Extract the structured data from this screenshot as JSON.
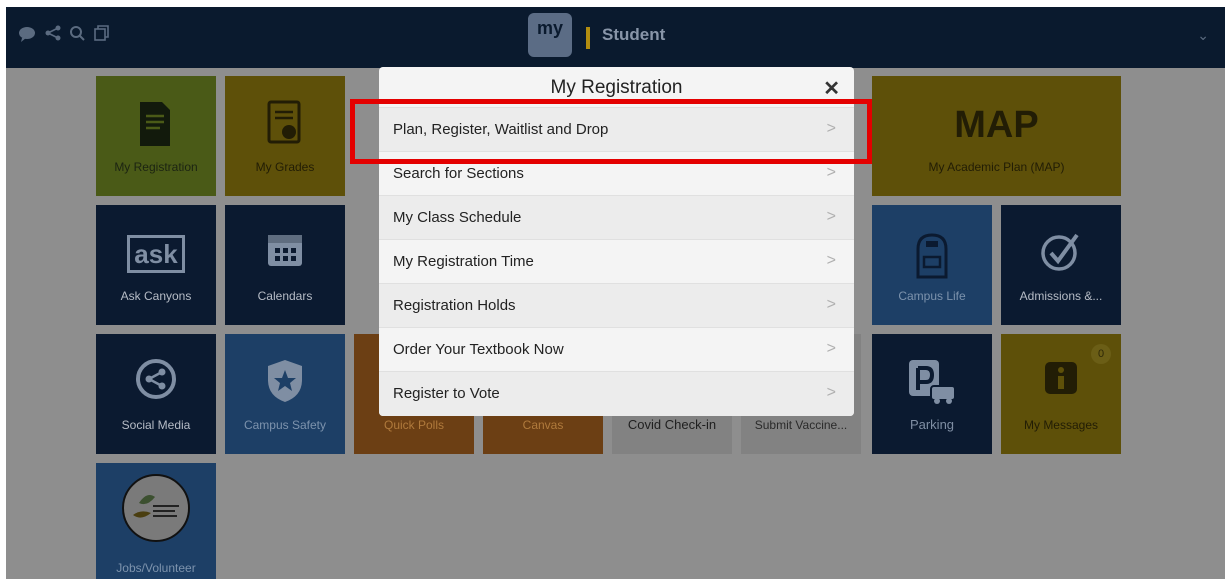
{
  "topbar": {
    "title": "Student",
    "logo_text": "my",
    "icons": [
      "chat-icon",
      "share-icon",
      "search-icon",
      "copy-icon"
    ],
    "chevron": "⌄"
  },
  "tiles": [
    {
      "label": "My Registration",
      "icon": "document-edit-icon"
    },
    {
      "label": "My Grades",
      "icon": "certificate-icon"
    },
    {
      "label": "My Academic Plan (MAP)",
      "icon": "map-logo-icon",
      "logo_text": "MAP"
    },
    {
      "label": "Ask Canyons",
      "icon": "ask-icon",
      "logo_text": "ask"
    },
    {
      "label": "Calendars",
      "icon": "calendar-icon"
    },
    {
      "label": "Campus Life",
      "icon": "backpack-icon"
    },
    {
      "label": "Admissions &...",
      "icon": "check-circle-icon"
    },
    {
      "label": "Social Media",
      "icon": "share-circle-icon"
    },
    {
      "label": "Campus Safety",
      "icon": "shield-star-icon"
    },
    {
      "label": "Quick Polls",
      "icon": ""
    },
    {
      "label": "Canvas",
      "icon": ""
    },
    {
      "label": "Covid Check-in",
      "icon": ""
    },
    {
      "label": "Submit Vaccine...",
      "icon": ""
    },
    {
      "label": "Parking",
      "icon": "parking-icon"
    },
    {
      "label": "My Messages",
      "icon": "info-icon",
      "badge": "0"
    },
    {
      "label": "Jobs/Volunteer",
      "icon": "jobs-logo-icon"
    }
  ],
  "modal": {
    "title": "My Registration",
    "close": "✕",
    "items": [
      {
        "label": "Plan, Register, Waitlist and Drop",
        "chevron": ">"
      },
      {
        "label": "Search for Sections",
        "chevron": ">"
      },
      {
        "label": "My Class Schedule",
        "chevron": ">"
      },
      {
        "label": "My Registration Time",
        "chevron": ">"
      },
      {
        "label": "Registration Holds",
        "chevron": ">"
      },
      {
        "label": "Order Your Textbook Now",
        "chevron": ">"
      },
      {
        "label": "Register to Vote",
        "chevron": ">"
      }
    ]
  },
  "highlight_color": "#e40000"
}
